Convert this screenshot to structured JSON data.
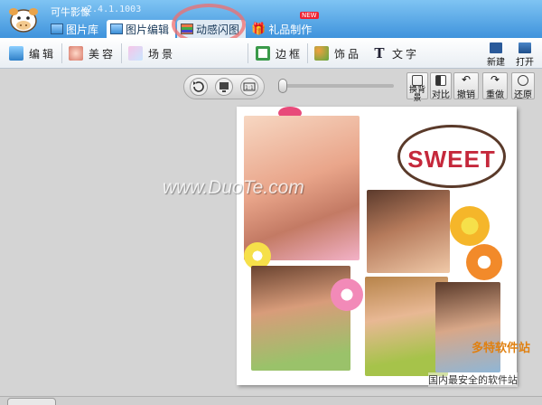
{
  "app": {
    "title": "可牛影像",
    "version": "v2.4.1.1003"
  },
  "tabs": [
    {
      "label": "图片库",
      "icon": "photo-library-icon"
    },
    {
      "label": "图片编辑",
      "icon": "photo-edit-icon"
    },
    {
      "label": "动感闪图",
      "icon": "animated-gif-icon"
    },
    {
      "label": "礼品制作",
      "icon": "gift-icon",
      "badge": "NEW"
    }
  ],
  "features": [
    {
      "label": "编辑",
      "icon": "edit-icon"
    },
    {
      "label": "美容",
      "icon": "beauty-icon"
    },
    {
      "label": "场景",
      "icon": "scene-icon"
    },
    {
      "label": "边框",
      "icon": "frame-icon"
    },
    {
      "label": "饰品",
      "icon": "ornament-icon"
    },
    {
      "label": "文字",
      "icon": "text-icon"
    }
  ],
  "right_actions": [
    {
      "label": "新建",
      "icon": "new-file-icon"
    },
    {
      "label": "打开",
      "icon": "open-folder-icon"
    }
  ],
  "work_tools": [
    {
      "label": "换背景",
      "icon": "change-background-icon"
    },
    {
      "label": "对比",
      "icon": "compare-icon"
    },
    {
      "label": "撤销",
      "icon": "undo-icon"
    },
    {
      "label": "重做",
      "icon": "redo-icon"
    },
    {
      "label": "还原",
      "icon": "restore-icon"
    }
  ],
  "canvas": {
    "bubble_text": "SWEET",
    "watermark": "www.DuoTe.com",
    "corner_text": "国内最安全的软件站",
    "corner_logo": "多特软件站"
  },
  "colors": {
    "titlebar": "#4a9ee4",
    "highlight_circle": "#f06e6e",
    "bubble_text": "#c5283b"
  }
}
